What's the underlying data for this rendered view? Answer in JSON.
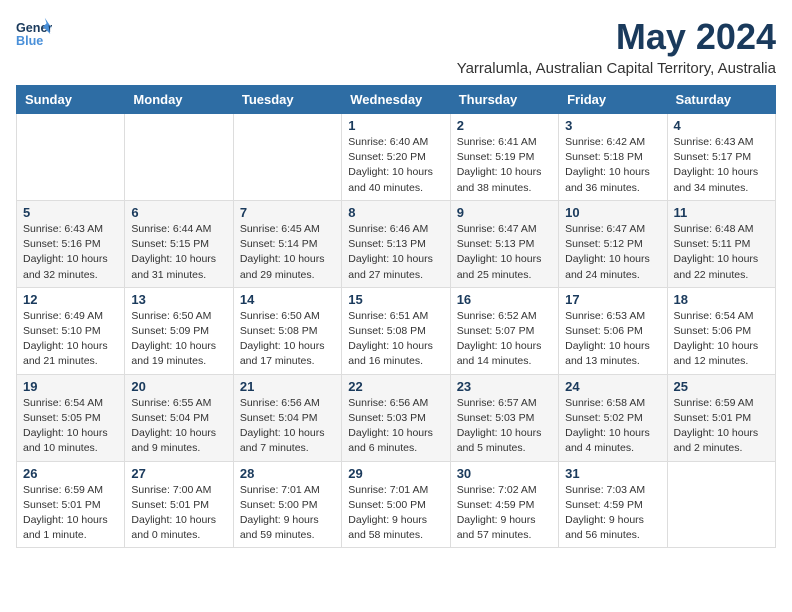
{
  "header": {
    "logo": {
      "line1": "General",
      "line2": "Blue"
    },
    "title": "May 2024",
    "subtitle": "Yarralumla, Australian Capital Territory, Australia"
  },
  "calendar": {
    "days_of_week": [
      "Sunday",
      "Monday",
      "Tuesday",
      "Wednesday",
      "Thursday",
      "Friday",
      "Saturday"
    ],
    "weeks": [
      [
        {
          "day": "",
          "info": ""
        },
        {
          "day": "",
          "info": ""
        },
        {
          "day": "",
          "info": ""
        },
        {
          "day": "1",
          "info": "Sunrise: 6:40 AM\nSunset: 5:20 PM\nDaylight: 10 hours\nand 40 minutes."
        },
        {
          "day": "2",
          "info": "Sunrise: 6:41 AM\nSunset: 5:19 PM\nDaylight: 10 hours\nand 38 minutes."
        },
        {
          "day": "3",
          "info": "Sunrise: 6:42 AM\nSunset: 5:18 PM\nDaylight: 10 hours\nand 36 minutes."
        },
        {
          "day": "4",
          "info": "Sunrise: 6:43 AM\nSunset: 5:17 PM\nDaylight: 10 hours\nand 34 minutes."
        }
      ],
      [
        {
          "day": "5",
          "info": "Sunrise: 6:43 AM\nSunset: 5:16 PM\nDaylight: 10 hours\nand 32 minutes."
        },
        {
          "day": "6",
          "info": "Sunrise: 6:44 AM\nSunset: 5:15 PM\nDaylight: 10 hours\nand 31 minutes."
        },
        {
          "day": "7",
          "info": "Sunrise: 6:45 AM\nSunset: 5:14 PM\nDaylight: 10 hours\nand 29 minutes."
        },
        {
          "day": "8",
          "info": "Sunrise: 6:46 AM\nSunset: 5:13 PM\nDaylight: 10 hours\nand 27 minutes."
        },
        {
          "day": "9",
          "info": "Sunrise: 6:47 AM\nSunset: 5:13 PM\nDaylight: 10 hours\nand 25 minutes."
        },
        {
          "day": "10",
          "info": "Sunrise: 6:47 AM\nSunset: 5:12 PM\nDaylight: 10 hours\nand 24 minutes."
        },
        {
          "day": "11",
          "info": "Sunrise: 6:48 AM\nSunset: 5:11 PM\nDaylight: 10 hours\nand 22 minutes."
        }
      ],
      [
        {
          "day": "12",
          "info": "Sunrise: 6:49 AM\nSunset: 5:10 PM\nDaylight: 10 hours\nand 21 minutes."
        },
        {
          "day": "13",
          "info": "Sunrise: 6:50 AM\nSunset: 5:09 PM\nDaylight: 10 hours\nand 19 minutes."
        },
        {
          "day": "14",
          "info": "Sunrise: 6:50 AM\nSunset: 5:08 PM\nDaylight: 10 hours\nand 17 minutes."
        },
        {
          "day": "15",
          "info": "Sunrise: 6:51 AM\nSunset: 5:08 PM\nDaylight: 10 hours\nand 16 minutes."
        },
        {
          "day": "16",
          "info": "Sunrise: 6:52 AM\nSunset: 5:07 PM\nDaylight: 10 hours\nand 14 minutes."
        },
        {
          "day": "17",
          "info": "Sunrise: 6:53 AM\nSunset: 5:06 PM\nDaylight: 10 hours\nand 13 minutes."
        },
        {
          "day": "18",
          "info": "Sunrise: 6:54 AM\nSunset: 5:06 PM\nDaylight: 10 hours\nand 12 minutes."
        }
      ],
      [
        {
          "day": "19",
          "info": "Sunrise: 6:54 AM\nSunset: 5:05 PM\nDaylight: 10 hours\nand 10 minutes."
        },
        {
          "day": "20",
          "info": "Sunrise: 6:55 AM\nSunset: 5:04 PM\nDaylight: 10 hours\nand 9 minutes."
        },
        {
          "day": "21",
          "info": "Sunrise: 6:56 AM\nSunset: 5:04 PM\nDaylight: 10 hours\nand 7 minutes."
        },
        {
          "day": "22",
          "info": "Sunrise: 6:56 AM\nSunset: 5:03 PM\nDaylight: 10 hours\nand 6 minutes."
        },
        {
          "day": "23",
          "info": "Sunrise: 6:57 AM\nSunset: 5:03 PM\nDaylight: 10 hours\nand 5 minutes."
        },
        {
          "day": "24",
          "info": "Sunrise: 6:58 AM\nSunset: 5:02 PM\nDaylight: 10 hours\nand 4 minutes."
        },
        {
          "day": "25",
          "info": "Sunrise: 6:59 AM\nSunset: 5:01 PM\nDaylight: 10 hours\nand 2 minutes."
        }
      ],
      [
        {
          "day": "26",
          "info": "Sunrise: 6:59 AM\nSunset: 5:01 PM\nDaylight: 10 hours\nand 1 minute."
        },
        {
          "day": "27",
          "info": "Sunrise: 7:00 AM\nSunset: 5:01 PM\nDaylight: 10 hours\nand 0 minutes."
        },
        {
          "day": "28",
          "info": "Sunrise: 7:01 AM\nSunset: 5:00 PM\nDaylight: 9 hours\nand 59 minutes."
        },
        {
          "day": "29",
          "info": "Sunrise: 7:01 AM\nSunset: 5:00 PM\nDaylight: 9 hours\nand 58 minutes."
        },
        {
          "day": "30",
          "info": "Sunrise: 7:02 AM\nSunset: 4:59 PM\nDaylight: 9 hours\nand 57 minutes."
        },
        {
          "day": "31",
          "info": "Sunrise: 7:03 AM\nSunset: 4:59 PM\nDaylight: 9 hours\nand 56 minutes."
        },
        {
          "day": "",
          "info": ""
        }
      ]
    ]
  }
}
